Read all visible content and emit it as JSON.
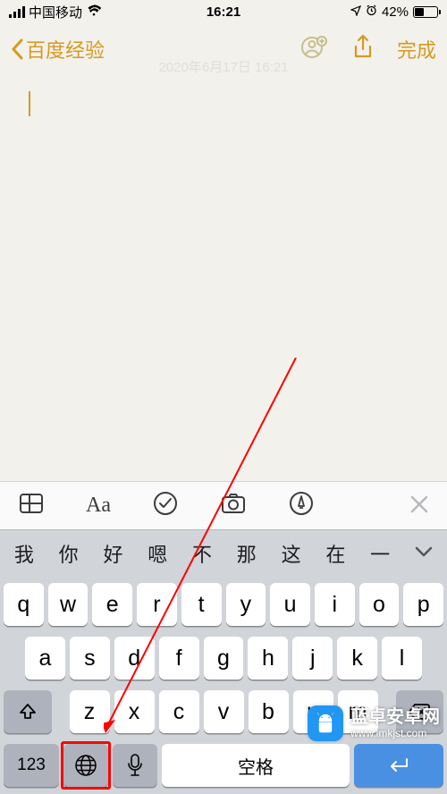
{
  "status": {
    "carrier": "中国移动",
    "time": "16:21",
    "battery_pct": "42%"
  },
  "nav": {
    "back_label": "百度经验",
    "done": "完成",
    "date_watermark": "2020年6月17日 16:21"
  },
  "toolbar": {
    "icons": [
      "table-icon",
      "text-format-icon",
      "checkmark-icon",
      "camera-icon",
      "markup-icon",
      "close-icon"
    ]
  },
  "candidates": [
    "我",
    "你",
    "好",
    "嗯",
    "不",
    "那",
    "这",
    "在",
    "一"
  ],
  "keyboard": {
    "row1": [
      "q",
      "w",
      "e",
      "r",
      "t",
      "y",
      "u",
      "i",
      "o",
      "p"
    ],
    "row2": [
      "a",
      "s",
      "d",
      "f",
      "g",
      "h",
      "j",
      "k",
      "l"
    ],
    "row3": [
      "z",
      "x",
      "c",
      "v",
      "b",
      "n",
      "m"
    ],
    "numkey": "123",
    "space": "空格"
  },
  "watermark": {
    "title": "蓝卓安卓网",
    "url": "www.lmkjst.com"
  }
}
